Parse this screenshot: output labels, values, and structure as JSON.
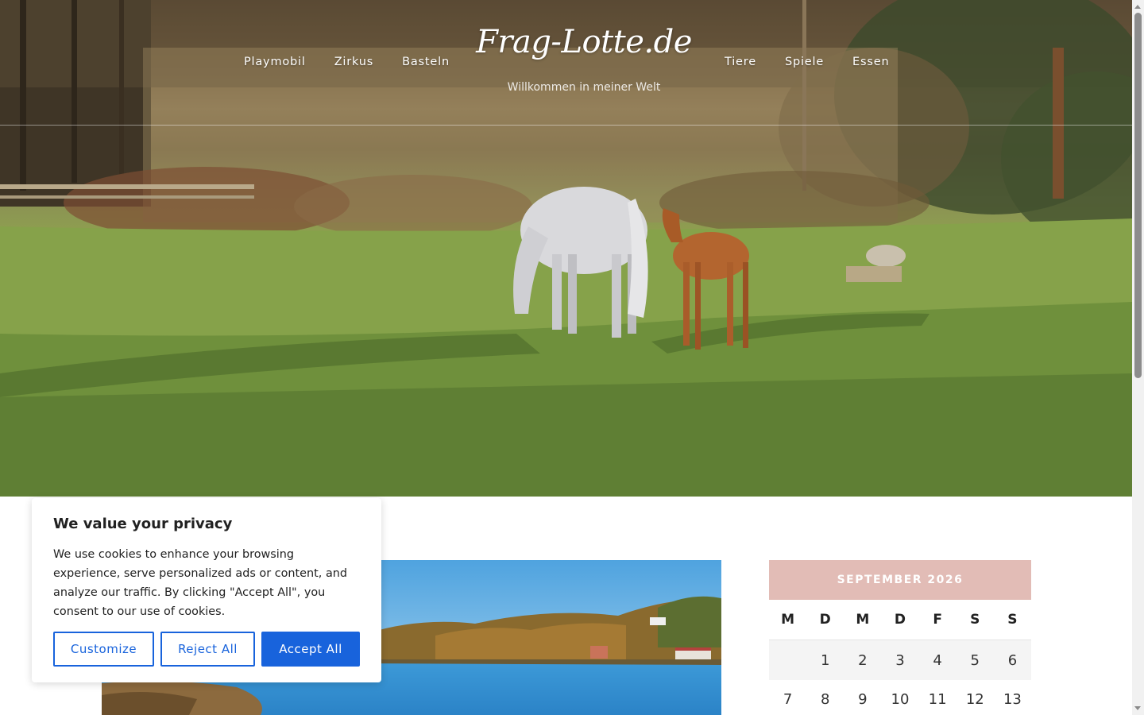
{
  "site": {
    "logo": "Frag-Lotte.de",
    "tagline": "Willkommen in meiner Welt"
  },
  "nav": {
    "left": [
      "Playmobil",
      "Zirkus",
      "Basteln"
    ],
    "right": [
      "Tiere",
      "Spiele",
      "Essen"
    ]
  },
  "calendar": {
    "caption": "SEPTEMBER 2026",
    "weekdays": [
      "M",
      "D",
      "M",
      "D",
      "F",
      "S",
      "S"
    ],
    "rows": [
      [
        "",
        "1",
        "2",
        "3",
        "4",
        "5",
        "6"
      ],
      [
        "7",
        "8",
        "9",
        "10",
        "11",
        "12",
        "13"
      ]
    ]
  },
  "cookie_banner": {
    "title": "We value your privacy",
    "text": "We use cookies to enhance your browsing experience, serve personalized ads or content, and analyze our traffic. By clicking \"Accept All\", you consent to our use of cookies.",
    "buttons": {
      "customize": "Customize",
      "reject": "Reject All",
      "accept": "Accept All"
    }
  },
  "colors": {
    "accent": "#1863dc",
    "calendar_header": "#e2bcb6"
  }
}
